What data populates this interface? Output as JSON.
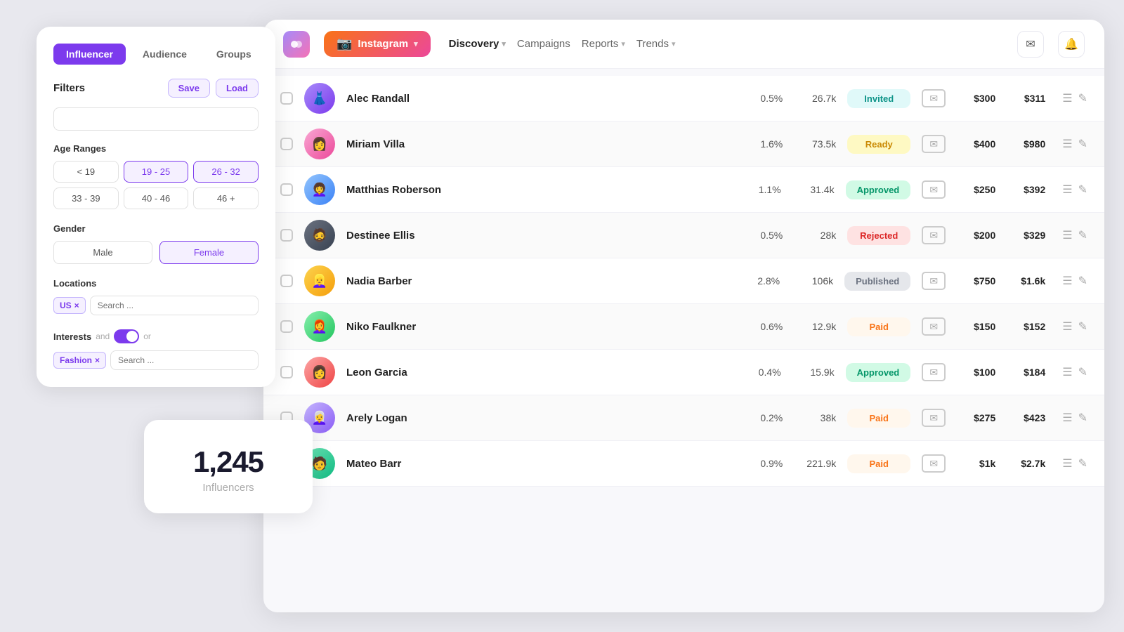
{
  "filterPanel": {
    "tabs": [
      "Influencer",
      "Audience",
      "Groups"
    ],
    "activeTab": "Influencer",
    "filtersTitle": "Filters",
    "saveLabel": "Save",
    "loadLabel": "Load",
    "ageRanges": {
      "title": "Age Ranges",
      "options": [
        "< 19",
        "19 - 25",
        "26 - 32",
        "33 - 39",
        "40 - 46",
        "46 +"
      ],
      "active": [
        "19 - 25",
        "26 - 32"
      ]
    },
    "gender": {
      "title": "Gender",
      "options": [
        "Male",
        "Female"
      ],
      "active": "Female"
    },
    "locations": {
      "title": "Locations",
      "tags": [
        "US"
      ],
      "searchPlaceholder": "Search ..."
    },
    "interests": {
      "title": "Interests",
      "and": "and",
      "or": "or",
      "tags": [
        "Fashion"
      ],
      "searchPlaceholder": "Search ..."
    }
  },
  "countCard": {
    "number": "1,245",
    "label": "Influencers"
  },
  "header": {
    "platform": "Instagram",
    "nav": [
      {
        "label": "Discovery",
        "hasChevron": true,
        "active": true
      },
      {
        "label": "Campaigns",
        "hasChevron": false,
        "active": false
      },
      {
        "label": "Reports",
        "hasChevron": true,
        "active": false
      },
      {
        "label": "Trends",
        "hasChevron": true,
        "active": false
      }
    ]
  },
  "tableRows": [
    {
      "id": 1,
      "name": "Alec Randall",
      "engRate": "0.5%",
      "followers": "26.7k",
      "status": "Invited",
      "statusClass": "badge-invited",
      "price1": "$300",
      "price2": "$311",
      "avClass": "av1",
      "emoji": "👗"
    },
    {
      "id": 2,
      "name": "Miriam Villa",
      "engRate": "1.6%",
      "followers": "73.5k",
      "status": "Ready",
      "statusClass": "badge-ready",
      "price1": "$400",
      "price2": "$980",
      "avClass": "av2",
      "emoji": "👩"
    },
    {
      "id": 3,
      "name": "Matthias Roberson",
      "engRate": "1.1%",
      "followers": "31.4k",
      "status": "Approved",
      "statusClass": "badge-approved",
      "price1": "$250",
      "price2": "$392",
      "avClass": "av3",
      "emoji": "👩‍🦱"
    },
    {
      "id": 4,
      "name": "Destinee Ellis",
      "engRate": "0.5%",
      "followers": "28k",
      "status": "Rejected",
      "statusClass": "badge-rejected",
      "price1": "$200",
      "price2": "$329",
      "avClass": "av4",
      "emoji": "🧔"
    },
    {
      "id": 5,
      "name": "Nadia Barber",
      "engRate": "2.8%",
      "followers": "106k",
      "status": "Published",
      "statusClass": "badge-published",
      "price1": "$750",
      "price2": "$1.6k",
      "avClass": "av5",
      "emoji": "👱‍♀️"
    },
    {
      "id": 6,
      "name": "Niko Faulkner",
      "engRate": "0.6%",
      "followers": "12.9k",
      "status": "Paid",
      "statusClass": "badge-paid",
      "price1": "$150",
      "price2": "$152",
      "avClass": "av6",
      "emoji": "👩‍🦰"
    },
    {
      "id": 7,
      "name": "Leon Garcia",
      "engRate": "0.4%",
      "followers": "15.9k",
      "status": "Approved",
      "statusClass": "badge-approved",
      "price1": "$100",
      "price2": "$184",
      "avClass": "av7",
      "emoji": "👩"
    },
    {
      "id": 8,
      "name": "Arely Logan",
      "engRate": "0.2%",
      "followers": "38k",
      "status": "Paid",
      "statusClass": "badge-paid",
      "price1": "$275",
      "price2": "$423",
      "avClass": "av8",
      "emoji": "👩‍🦳"
    },
    {
      "id": 9,
      "name": "Mateo Barr",
      "engRate": "0.9%",
      "followers": "221.9k",
      "status": "Paid",
      "statusClass": "badge-paid",
      "price1": "$1k",
      "price2": "$2.7k",
      "avClass": "av9",
      "emoji": "🧑"
    }
  ]
}
